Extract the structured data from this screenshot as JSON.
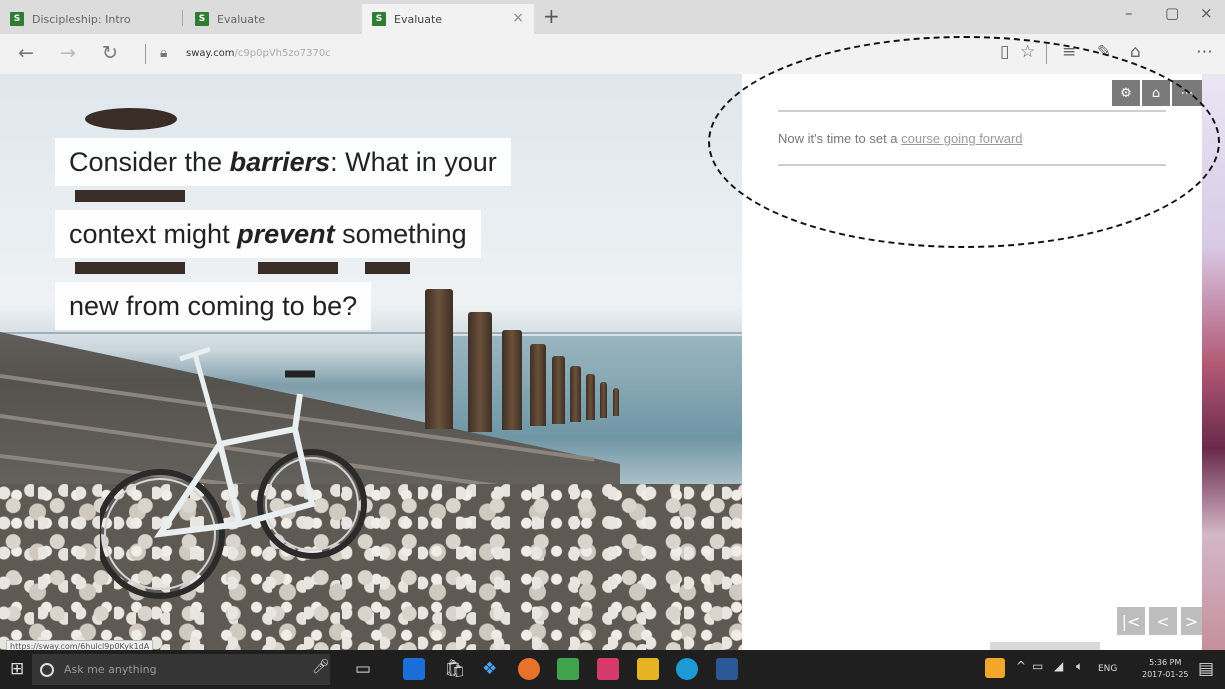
{
  "tabs": [
    {
      "title": "Discipleship: Intro",
      "favicon": "S",
      "active": false
    },
    {
      "title": "Evaluate",
      "favicon": "S",
      "active": false
    },
    {
      "title": "Evaluate",
      "favicon": "S",
      "active": true
    }
  ],
  "window": {
    "minimize": "–",
    "maximize": "▢",
    "close": "×",
    "tab_close": "×",
    "new_tab": "+"
  },
  "address": {
    "domain": "sway.com",
    "path": "/c9p0pVh5zo7370c"
  },
  "slide": {
    "line1_pre": "Consider the ",
    "line1_em": "barriers",
    "line1_post": ": What in your",
    "line2_pre": "context might ",
    "line2_em": "prevent",
    "line2_post": " something",
    "line3": "new from coming to be?"
  },
  "status_url": "https://sway.com/6hulcl9p0Kyk1dA",
  "right_pane": {
    "text": "Now it's time to set a ",
    "link": "course going forward"
  },
  "taskbar": {
    "search_placeholder": "Ask me anything",
    "language": "ENG",
    "time": "5:36 PM",
    "date": "2017-01-25"
  }
}
